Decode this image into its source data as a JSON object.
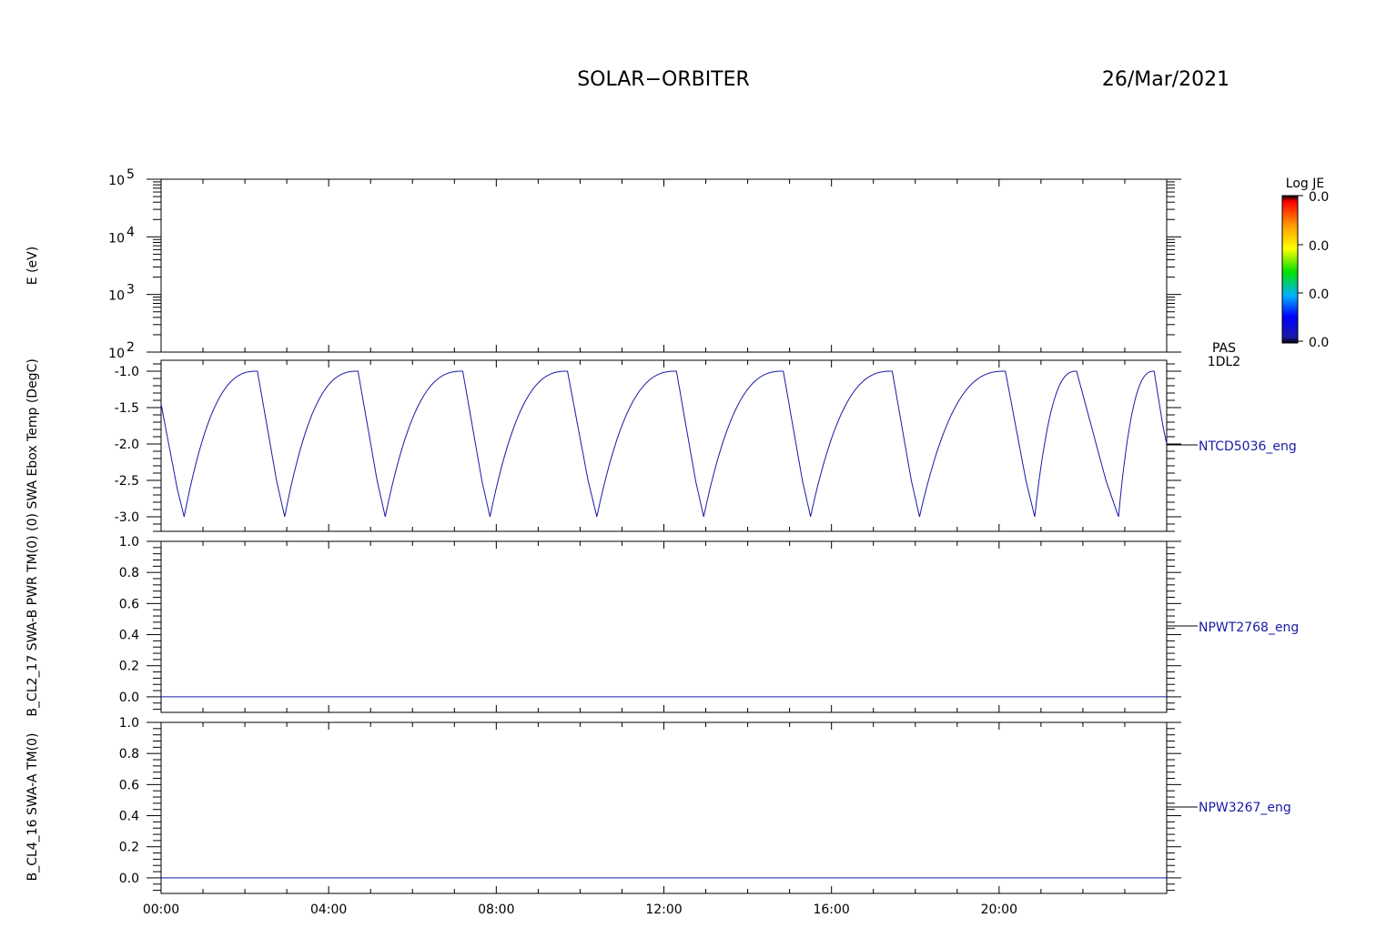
{
  "header": {
    "mission": "SOLAR−ORBITER",
    "date": "26/Mar/2021"
  },
  "colorbar": {
    "title": "Log JE",
    "tick_labels": [
      "0.0",
      "0.0",
      "0.0",
      "0.0"
    ],
    "instrument_label_1": "PAS",
    "instrument_label_2": "1DL2"
  },
  "x_tick_labels": [
    "00:00",
    "04:00",
    "08:00",
    "12:00",
    "16:00",
    "20:00"
  ],
  "colors": {
    "trace": "#1a1aa6",
    "axis": "#000000"
  },
  "chart_data": [
    {
      "type": "heatmap",
      "ylabel": "E (eV)",
      "y_scale": "log",
      "ylim": [
        100,
        100000
      ],
      "y_ticks": [
        {
          "base": "10",
          "exp": "2"
        },
        {
          "base": "10",
          "exp": "3"
        },
        {
          "base": "10",
          "exp": "4"
        },
        {
          "base": "10",
          "exp": "5"
        }
      ],
      "xlim_hours": [
        0,
        24
      ],
      "colorbar_title": "Log JE",
      "colorbar_ticks": [
        "0.0",
        "0.0",
        "0.0",
        "0.0"
      ],
      "values": []
    },
    {
      "type": "line",
      "ylabel": "(0) SWA Ebox Temp (DegC)",
      "series_label": "NTCD5036_eng",
      "ylim": [
        -3.2,
        -0.85
      ],
      "y_tick_labels": [
        "-1.0",
        "-1.5",
        "-2.0",
        "-2.5",
        "-3.0"
      ],
      "y_tick_values": [
        -1.0,
        -1.5,
        -2.0,
        -2.5,
        -3.0
      ],
      "x_hours": [
        0.0,
        0.55,
        2.3,
        2.95,
        4.7,
        5.35,
        7.2,
        7.85,
        9.7,
        10.4,
        12.3,
        12.95,
        14.85,
        15.5,
        17.45,
        18.1,
        20.15,
        20.85,
        21.85,
        22.85,
        23.7,
        24.0
      ],
      "y": [
        -1.45,
        -3.0,
        -1.0,
        -3.0,
        -1.0,
        -3.0,
        -1.0,
        -3.0,
        -1.0,
        -3.0,
        -1.0,
        -3.0,
        -1.0,
        -3.0,
        -1.0,
        -3.0,
        -1.0,
        -3.0,
        -1.0,
        -3.0,
        -1.0,
        -2.0
      ]
    },
    {
      "type": "line",
      "ylabel": "B_CL2_17 SWA-B PWR TM(0)",
      "series_label": "NPWT2768_eng",
      "ylim": [
        -0.1,
        1.0
      ],
      "y_tick_labels": [
        "1.0",
        "0.8",
        "0.6",
        "0.4",
        "0.2",
        "0.0"
      ],
      "y_tick_values": [
        1.0,
        0.8,
        0.6,
        0.4,
        0.2,
        0.0
      ],
      "x_hours": [
        0,
        24
      ],
      "y": [
        0.0,
        0.0
      ]
    },
    {
      "type": "line",
      "ylabel": "B_CL4_16 SWA-A TM(0)",
      "series_label": "NPW3267_eng",
      "ylim": [
        -0.1,
        1.0
      ],
      "y_tick_labels": [
        "1.0",
        "0.8",
        "0.6",
        "0.4",
        "0.2",
        "0.0"
      ],
      "y_tick_values": [
        1.0,
        0.8,
        0.6,
        0.4,
        0.2,
        0.0
      ],
      "x_hours": [
        0,
        24
      ],
      "y": [
        0.0,
        0.0
      ]
    }
  ]
}
